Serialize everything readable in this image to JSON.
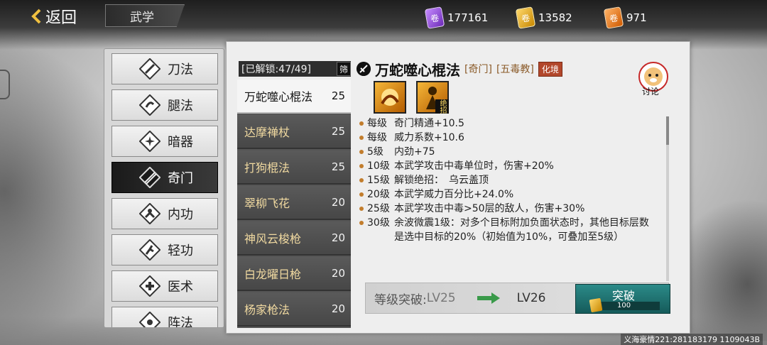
{
  "topbar": {
    "back_label": "返回",
    "page_tab": "武学",
    "currencies": [
      {
        "name": "purple-currency",
        "value": "177161"
      },
      {
        "name": "gold-currency",
        "value": "13582"
      },
      {
        "name": "orange-currency",
        "value": "971"
      }
    ]
  },
  "categories": [
    "刀法",
    "腿法",
    "暗器",
    "奇门",
    "内功",
    "轻功",
    "医术",
    "阵法"
  ],
  "active_category": "奇门",
  "unlock": {
    "label": "[已解锁:47/49]",
    "filter": "筛"
  },
  "skills": [
    {
      "name": "万蛇噬心棍法",
      "level": "25"
    },
    {
      "name": "达摩禅杖",
      "level": "25"
    },
    {
      "name": "打狗棍法",
      "level": "25"
    },
    {
      "name": "翠柳飞花",
      "level": "20"
    },
    {
      "name": "神风云梭枪",
      "level": "20"
    },
    {
      "name": "白龙曜日枪",
      "level": "20"
    },
    {
      "name": "杨家枪法",
      "level": "20"
    }
  ],
  "detail": {
    "title": "万蛇噬心棍法",
    "tag_type": "[奇门]",
    "tag_sect": "[五毒教]",
    "tag_realm": "化境",
    "discuss": "讨论",
    "move_badge": "绝招",
    "effects": [
      {
        "lv": "每级",
        "desc": "奇门精通+10.5"
      },
      {
        "lv": "每级",
        "desc": "威力系数+10.6"
      },
      {
        "lv": "5级",
        "desc": "内劲+75"
      },
      {
        "lv": "10级",
        "desc": "本武学攻击中毒单位时，伤害+20%"
      },
      {
        "lv": "15级",
        "desc": "解锁绝招：　乌云盖顶"
      },
      {
        "lv": "20级",
        "desc": "本武学威力百分比+24.0%"
      },
      {
        "lv": "25级",
        "desc": "本武学攻击中毒>50层的敌人，伤害+30%"
      },
      {
        "lv": "30级",
        "desc": "余波微震1级：对多个目标附加负面状态时，其他目标层数是选中目标的20%（初始值为10%，可叠加至5级）"
      }
    ],
    "breakthrough": {
      "label": "等级突破:",
      "from": "LV25",
      "to": "LV26",
      "button": "突破",
      "cost": "100"
    }
  },
  "footer": "义海豪情221:281183179 1109043B",
  "colors": {
    "accent_teal": "#1f7472",
    "skill_gold": "#f0d9a0",
    "badge_red": "#b2472b"
  }
}
